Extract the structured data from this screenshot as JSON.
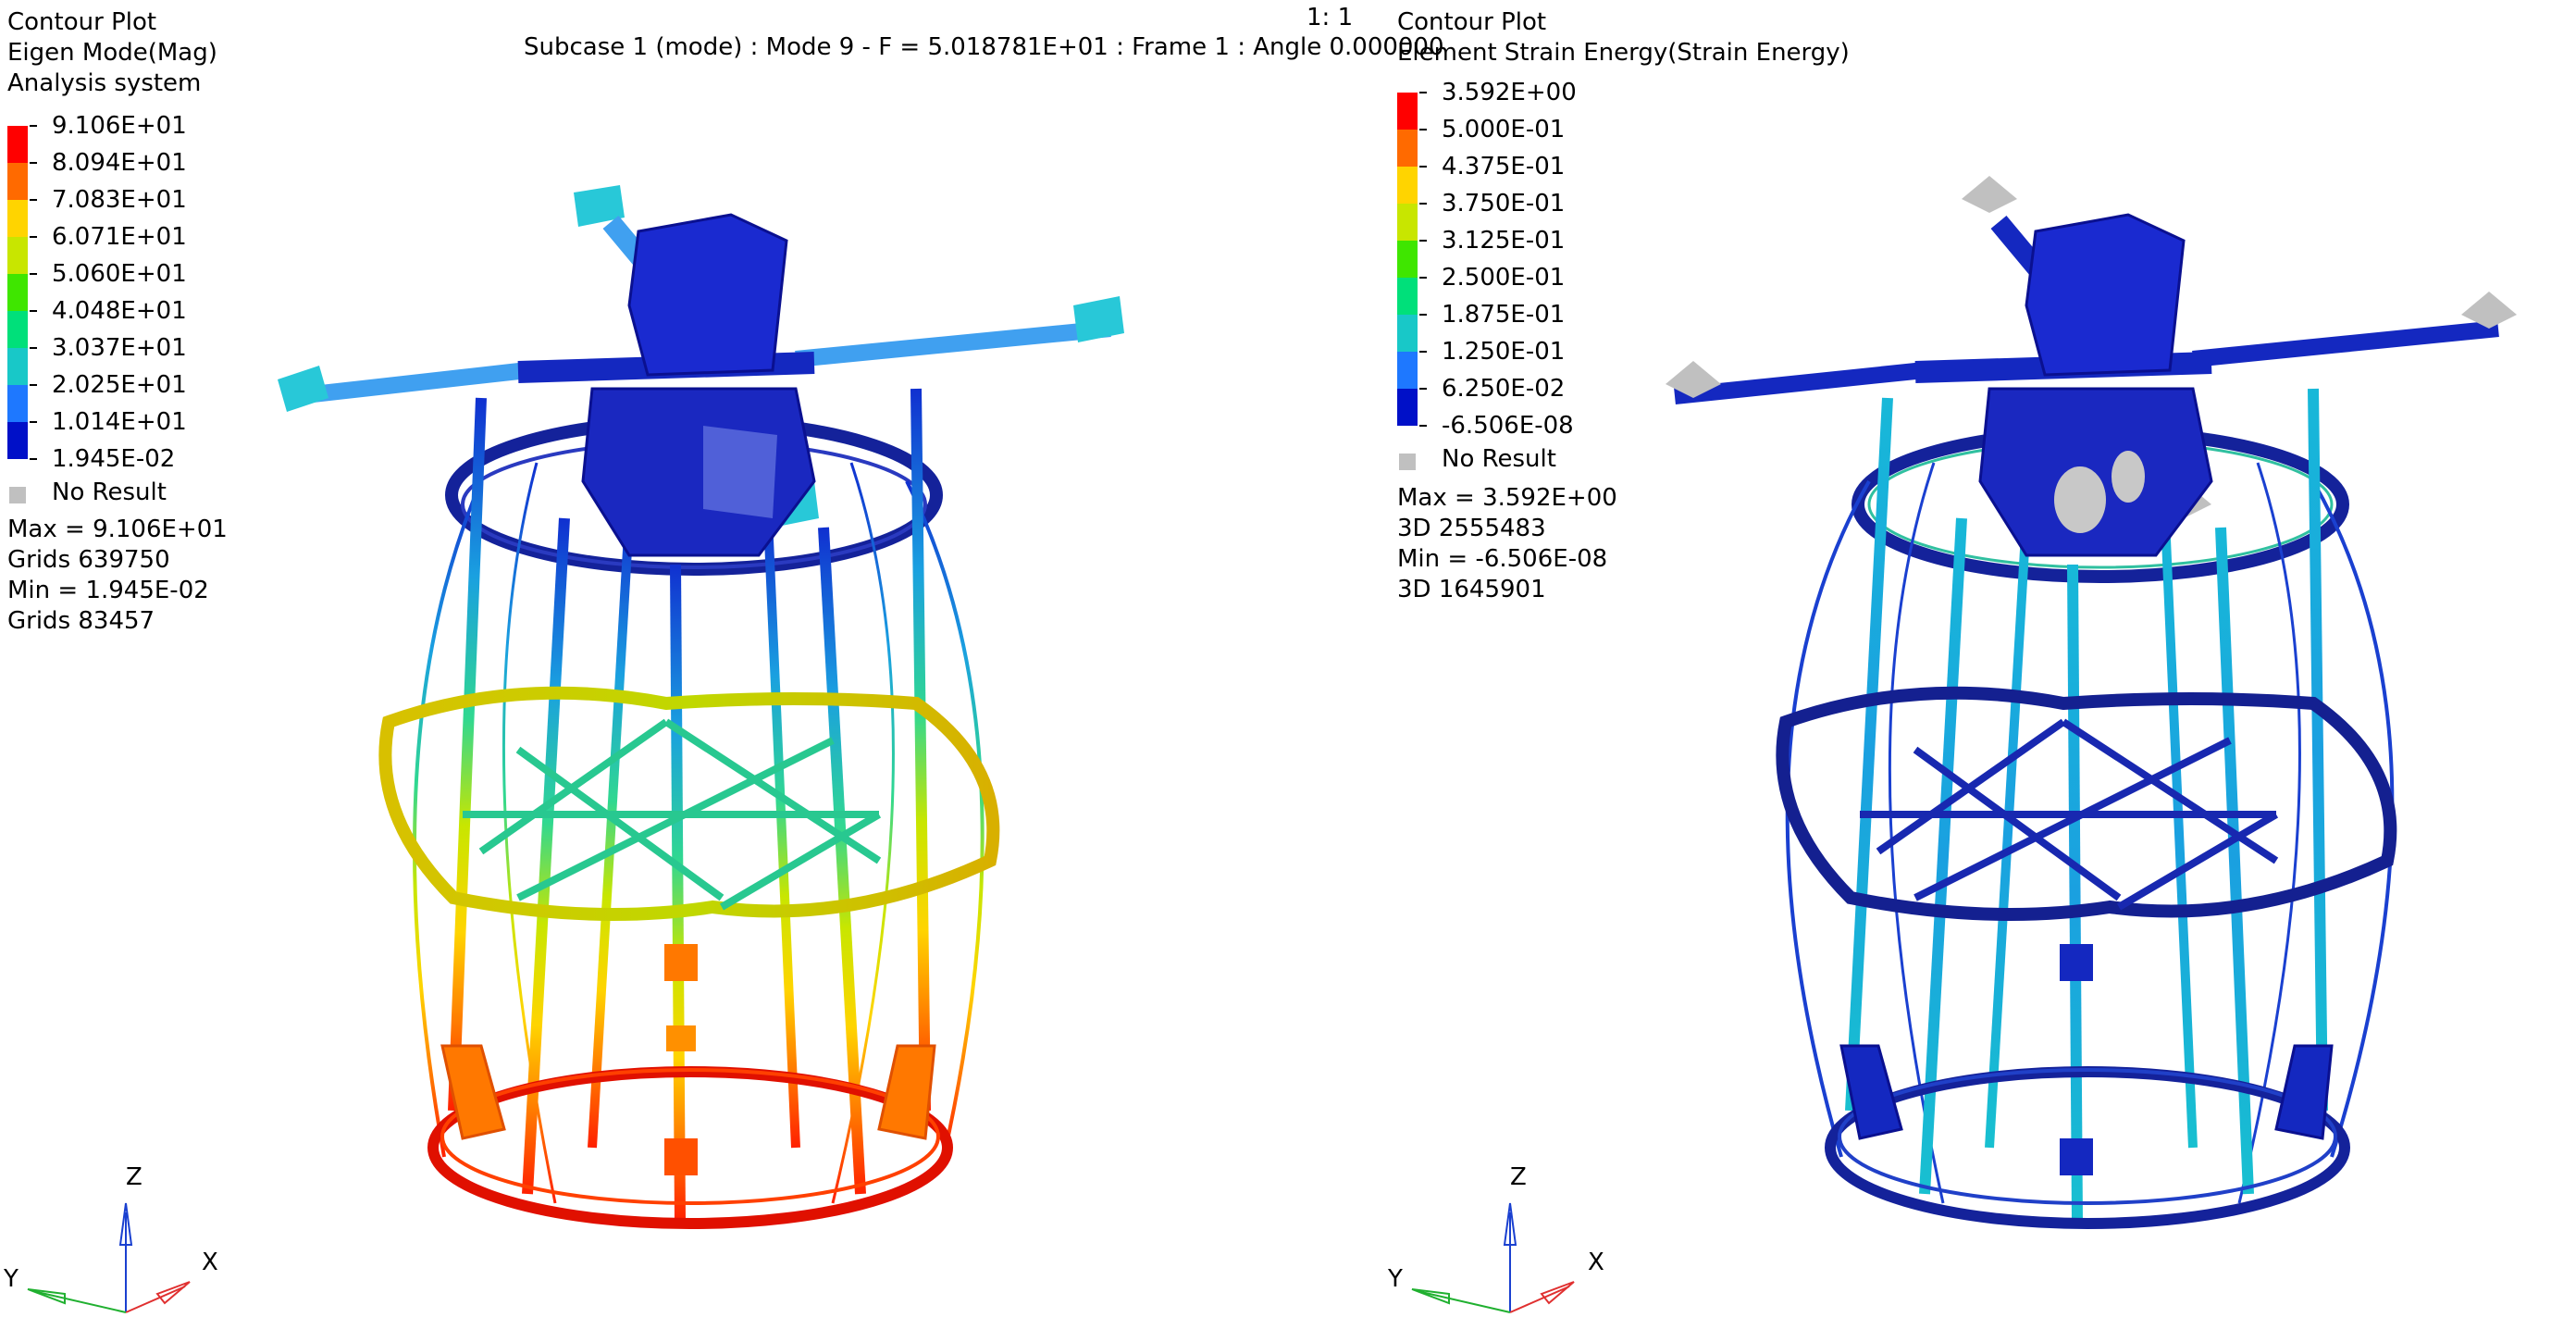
{
  "header": {
    "zoom": "1: 1",
    "subcase": "Subcase 1 (mode) : Mode 9 - F = 5.018781E+01 : Frame 1 : Angle 0.000000"
  },
  "left": {
    "title_lines": [
      "Contour Plot",
      "Eigen Mode(Mag)",
      "Analysis system"
    ],
    "legend_values": [
      "9.106E+01",
      "8.094E+01",
      "7.083E+01",
      "6.071E+01",
      "5.060E+01",
      "4.048E+01",
      "3.037E+01",
      "2.025E+01",
      "1.014E+01",
      "1.945E-02"
    ],
    "legend_colors": [
      "#ff0000",
      "#ff6a00",
      "#ffd400",
      "#c8e600",
      "#3fe600",
      "#00e07a",
      "#18c8c8",
      "#1e78ff",
      "#0010c8"
    ],
    "no_result": "No Result",
    "stats": [
      "Max =  9.106E+01",
      "Grids 639750",
      "Min =  1.945E-02",
      "Grids 83457"
    ]
  },
  "right": {
    "title_lines": [
      "Contour Plot",
      "Element Strain Energy(Strain Energy)"
    ],
    "legend_values": [
      "3.592E+00",
      "5.000E-01",
      "4.375E-01",
      "3.750E-01",
      "3.125E-01",
      "2.500E-01",
      "1.875E-01",
      "1.250E-01",
      "6.250E-02",
      "-6.506E-08"
    ],
    "legend_colors": [
      "#ff0000",
      "#ff6a00",
      "#ffd400",
      "#c8e600",
      "#3fe600",
      "#00e07a",
      "#18c8c8",
      "#1e78ff",
      "#0010c8"
    ],
    "no_result": "No Result",
    "stats": [
      "Max =  3.592E+00",
      "3D 2555483",
      "Min =  -6.506E-08",
      "3D 1645901"
    ]
  },
  "triad": {
    "z": "Z",
    "x": "X",
    "y": "Y"
  },
  "colors": {
    "no_result_gray": "#c0c0c0",
    "mesh_blue": "#1020b4"
  }
}
